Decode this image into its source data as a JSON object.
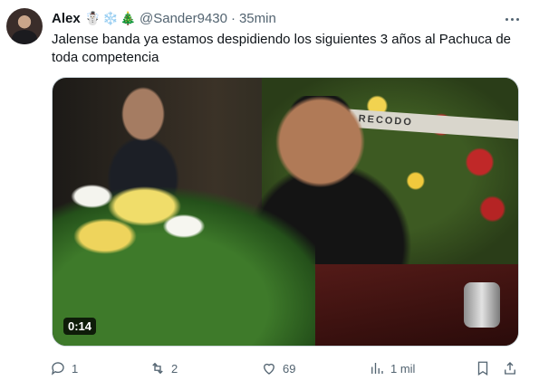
{
  "tweet": {
    "author_name": "Alex",
    "author_emojis": [
      "☃️",
      "❄️",
      "🎄"
    ],
    "handle": "@Sander9430",
    "separator": "·",
    "time": "35min",
    "text": "Jalense banda ya estamos despidiendo los siguientes 3 años al Pachuca de toda competencia"
  },
  "media": {
    "banner_text": "A EL RECODO",
    "duration": "0:14"
  },
  "actions": {
    "replies": "1",
    "reposts": "2",
    "likes": "69",
    "views": "1 mil"
  },
  "icons": [
    "more-icon",
    "reply-icon",
    "repost-icon",
    "like-icon",
    "views-icon",
    "bookmark-icon",
    "share-icon"
  ],
  "colors": {
    "text": "#0f1419",
    "secondary": "#536471",
    "border": "#cfd9de"
  }
}
